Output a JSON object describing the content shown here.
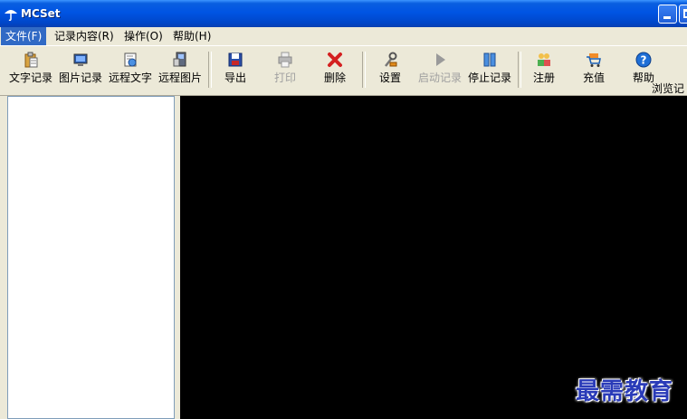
{
  "window": {
    "title": "MCSet"
  },
  "menu": {
    "items": [
      {
        "label": "文件(F)",
        "active": true
      },
      {
        "label": "记录内容(R)"
      },
      {
        "label": "操作(O)"
      },
      {
        "label": "帮助(H)"
      }
    ]
  },
  "toolbar": {
    "buttons": [
      {
        "label": "文字记录",
        "icon": "clipboard-text-icon"
      },
      {
        "label": "图片记录",
        "icon": "image-record-icon"
      },
      {
        "label": "远程文字",
        "icon": "remote-text-icon"
      },
      {
        "label": "远程图片",
        "icon": "remote-image-icon"
      },
      {
        "label": "导出",
        "icon": "save-disk-icon"
      },
      {
        "label": "打印",
        "icon": "printer-icon",
        "disabled": true
      },
      {
        "label": "删除",
        "icon": "delete-x-icon"
      },
      {
        "label": "设置",
        "icon": "settings-tools-icon"
      },
      {
        "label": "启动记录",
        "icon": "play-icon",
        "disabled": true
      },
      {
        "label": "停止记录",
        "icon": "pause-icon"
      },
      {
        "label": "注册",
        "icon": "register-users-icon"
      },
      {
        "label": "充值",
        "icon": "cart-icon"
      },
      {
        "label": "帮助",
        "icon": "help-icon"
      }
    ],
    "browse_label": "浏览记"
  },
  "watermark": "最需教育",
  "colors": {
    "titlebar": "#0054e3",
    "menu_active": "#316ac5",
    "preview_bg": "#000000",
    "watermark": "#2a3bb8"
  }
}
